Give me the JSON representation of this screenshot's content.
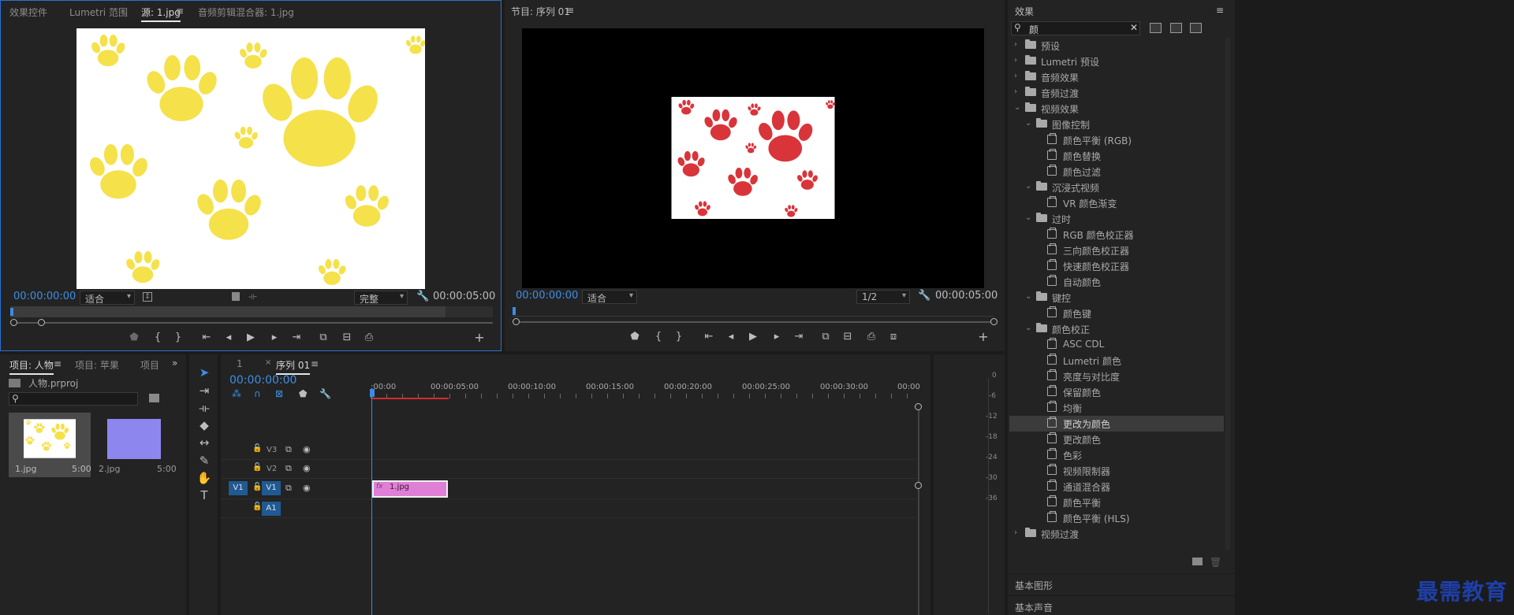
{
  "source_panel": {
    "tabs": [
      "效果控件",
      "Lumetri 范围",
      "源: 1.jpg",
      "音频剪辑混合器: 1.jpg"
    ],
    "timecode_in": "00:00:00:00",
    "fit": "适合",
    "quality": "完整",
    "timecode_out": "00:00:05:00"
  },
  "program_panel": {
    "title": "节目: 序列 01",
    "timecode_in": "00:00:00:00",
    "fit": "适合",
    "resolution": "1/2",
    "timecode_out": "00:00:05:00"
  },
  "effects_panel": {
    "title": "效果",
    "search_value": "颜",
    "tree": [
      {
        "label": "预设",
        "level": 0,
        "kind": "folder-special",
        "expanded": false
      },
      {
        "label": "Lumetri 预设",
        "level": 0,
        "kind": "folder-special",
        "expanded": false
      },
      {
        "label": "音频效果",
        "level": 0,
        "kind": "folder",
        "expanded": false
      },
      {
        "label": "音频过渡",
        "level": 0,
        "kind": "folder",
        "expanded": false
      },
      {
        "label": "视频效果",
        "level": 0,
        "kind": "folder",
        "expanded": true
      },
      {
        "label": "图像控制",
        "level": 1,
        "kind": "folder",
        "expanded": true
      },
      {
        "label": "颜色平衡 (RGB)",
        "level": 2,
        "kind": "effect"
      },
      {
        "label": "颜色替换",
        "level": 2,
        "kind": "effect"
      },
      {
        "label": "颜色过滤",
        "level": 2,
        "kind": "effect"
      },
      {
        "label": "沉浸式视频",
        "level": 1,
        "kind": "folder",
        "expanded": true
      },
      {
        "label": "VR 颜色渐变",
        "level": 2,
        "kind": "effect"
      },
      {
        "label": "过时",
        "level": 1,
        "kind": "folder",
        "expanded": true
      },
      {
        "label": "RGB 颜色校正器",
        "level": 2,
        "kind": "effect"
      },
      {
        "label": "三向颜色校正器",
        "level": 2,
        "kind": "effect"
      },
      {
        "label": "快速颜色校正器",
        "level": 2,
        "kind": "effect"
      },
      {
        "label": "自动颜色",
        "level": 2,
        "kind": "effect"
      },
      {
        "label": "键控",
        "level": 1,
        "kind": "folder",
        "expanded": true
      },
      {
        "label": "颜色键",
        "level": 2,
        "kind": "effect"
      },
      {
        "label": "颜色校正",
        "level": 1,
        "kind": "folder",
        "expanded": true
      },
      {
        "label": "ASC CDL",
        "level": 2,
        "kind": "effect"
      },
      {
        "label": "Lumetri 颜色",
        "level": 2,
        "kind": "effect"
      },
      {
        "label": "亮度与对比度",
        "level": 2,
        "kind": "effect"
      },
      {
        "label": "保留颜色",
        "level": 2,
        "kind": "effect"
      },
      {
        "label": "均衡",
        "level": 2,
        "kind": "effect"
      },
      {
        "label": "更改为颜色",
        "level": 2,
        "kind": "effect",
        "selected": true
      },
      {
        "label": "更改颜色",
        "level": 2,
        "kind": "effect"
      },
      {
        "label": "色彩",
        "level": 2,
        "kind": "effect"
      },
      {
        "label": "视频限制器",
        "level": 2,
        "kind": "effect"
      },
      {
        "label": "通道混合器",
        "level": 2,
        "kind": "effect"
      },
      {
        "label": "颜色平衡",
        "level": 2,
        "kind": "effect"
      },
      {
        "label": "颜色平衡 (HLS)",
        "level": 2,
        "kind": "effect"
      },
      {
        "label": "视频过渡",
        "level": 0,
        "kind": "folder",
        "expanded": false
      }
    ],
    "bottom_sections": [
      "基本图形",
      "基本声音"
    ]
  },
  "project_panel": {
    "tabs": [
      "项目: 人物",
      "项目: 苹果",
      "项目"
    ],
    "project_file": "人物.prproj",
    "items": [
      {
        "name": "1.jpg",
        "duration": "5:00"
      },
      {
        "name": "2.jpg",
        "duration": "5:00"
      }
    ]
  },
  "timeline": {
    "tabs": [
      "1",
      "序列 01"
    ],
    "timecode": "00:00:00:00",
    "ruler": [
      ":00:00",
      "00:00:05:00",
      "00:00:10:00",
      "00:00:15:00",
      "00:00:20:00",
      "00:00:25:00",
      "00:00:30:00",
      "00:00"
    ],
    "tracks": [
      "V3",
      "V2",
      "V1",
      "A1"
    ],
    "source_patch": "V1",
    "clip_name": "1.jpg",
    "clip_fx": "fx"
  },
  "audio_meter": {
    "scale": [
      "0",
      "-6",
      "-12",
      "-18",
      "-24",
      "-30",
      "-36"
    ]
  },
  "watermark": "最需教育",
  "colors": {
    "accent_blue": "#3d8ee6",
    "paw_yellow": "#f5e14a",
    "paw_red": "#d9343a",
    "clip_pink": "#e07fd6",
    "playhead_blue": "#3b8be8",
    "work_area_red": "#d42c2c"
  }
}
